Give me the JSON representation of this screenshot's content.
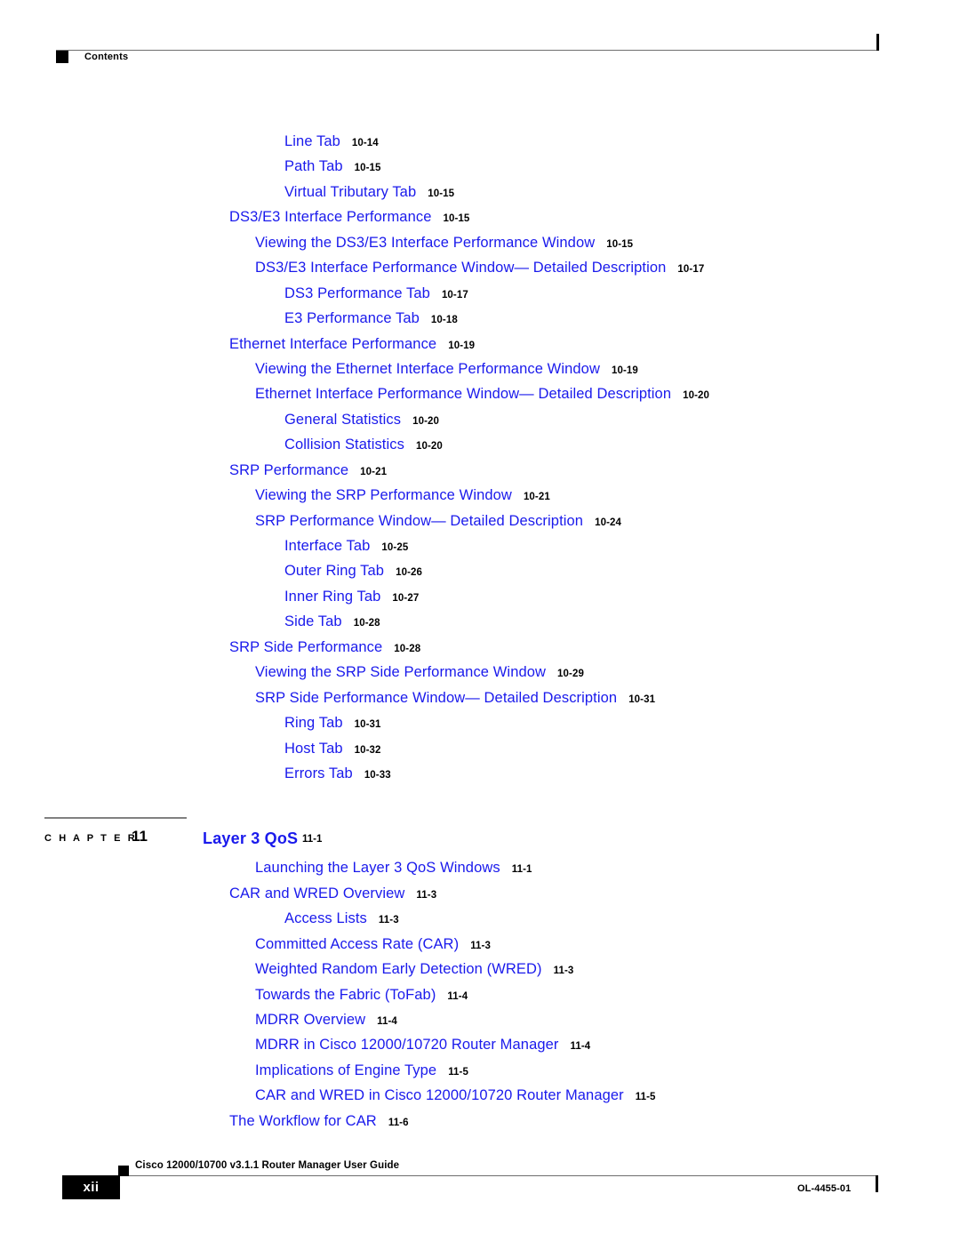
{
  "header": {
    "label": "Contents",
    "marker_icon": "black-square-icon"
  },
  "toc": {
    "entries": [
      {
        "title": "Line Tab",
        "page": "10-14",
        "level": 3
      },
      {
        "title": "Path Tab",
        "page": "10-15",
        "level": 3
      },
      {
        "title": "Virtual Tributary Tab",
        "page": "10-15",
        "level": 3
      },
      {
        "title": "DS3/E3 Interface Performance",
        "page": "10-15",
        "level": 1
      },
      {
        "title": "Viewing the DS3/E3 Interface Performance Window",
        "page": "10-15",
        "level": 2
      },
      {
        "title": "DS3/E3 Interface Performance Window— Detailed Description",
        "page": "10-17",
        "level": 2
      },
      {
        "title": "DS3 Performance Tab",
        "page": "10-17",
        "level": 3
      },
      {
        "title": "E3 Performance Tab",
        "page": "10-18",
        "level": 3
      },
      {
        "title": "Ethernet Interface Performance",
        "page": "10-19",
        "level": 1
      },
      {
        "title": "Viewing the Ethernet Interface Performance Window",
        "page": "10-19",
        "level": 2
      },
      {
        "title": "Ethernet Interface Performance Window— Detailed Description",
        "page": "10-20",
        "level": 2
      },
      {
        "title": "General Statistics",
        "page": "10-20",
        "level": 3
      },
      {
        "title": "Collision Statistics",
        "page": "10-20",
        "level": 3
      },
      {
        "title": "SRP Performance",
        "page": "10-21",
        "level": 1
      },
      {
        "title": "Viewing the SRP Performance Window",
        "page": "10-21",
        "level": 2
      },
      {
        "title": "SRP Performance Window— Detailed Description",
        "page": "10-24",
        "level": 2
      },
      {
        "title": "Interface Tab",
        "page": "10-25",
        "level": 3
      },
      {
        "title": "Outer Ring Tab",
        "page": "10-26",
        "level": 3
      },
      {
        "title": "Inner Ring Tab",
        "page": "10-27",
        "level": 3
      },
      {
        "title": "Side Tab",
        "page": "10-28",
        "level": 3
      },
      {
        "title": "SRP Side Performance",
        "page": "10-28",
        "level": 1
      },
      {
        "title": "Viewing the SRP Side Performance Window",
        "page": "10-29",
        "level": 2
      },
      {
        "title": "SRP Side Performance Window— Detailed Description",
        "page": "10-31",
        "level": 2
      },
      {
        "title": "Ring Tab",
        "page": "10-31",
        "level": 3
      },
      {
        "title": "Host Tab",
        "page": "10-32",
        "level": 3
      },
      {
        "title": "Errors Tab",
        "page": "10-33",
        "level": 3
      }
    ]
  },
  "chapter": {
    "word": "C H A P T E R",
    "number": "11",
    "title": "Layer 3 QoS",
    "page": "11-1"
  },
  "toc2": {
    "entries": [
      {
        "title": "Launching the Layer 3 QoS Windows",
        "page": "11-1",
        "level": 2
      },
      {
        "title": "CAR and WRED Overview",
        "page": "11-3",
        "level": 1
      },
      {
        "title": "Access Lists",
        "page": "11-3",
        "level": 3
      },
      {
        "title": "Committed Access Rate (CAR)",
        "page": "11-3",
        "level": 2
      },
      {
        "title": "Weighted Random Early Detection (WRED)",
        "page": "11-3",
        "level": 2
      },
      {
        "title": "Towards the Fabric (ToFab)",
        "page": "11-4",
        "level": 2
      },
      {
        "title": "MDRR Overview",
        "page": "11-4",
        "level": 2
      },
      {
        "title": "MDRR in Cisco 12000/10720 Router Manager",
        "page": "11-4",
        "level": 2
      },
      {
        "title": "Implications of Engine Type",
        "page": "11-5",
        "level": 2
      },
      {
        "title": "CAR and WRED in Cisco 12000/10720 Router Manager",
        "page": "11-5",
        "level": 2
      },
      {
        "title": "The Workflow for CAR",
        "page": "11-6",
        "level": 1
      }
    ]
  },
  "footer": {
    "page_number": "xii",
    "guide_title": "Cisco 12000/10700 v3.1.1 Router Manager User Guide",
    "doc_id": "OL-4455-01",
    "marker_icon": "black-square-icon"
  },
  "colors": {
    "link_blue": "#1a1aec",
    "rule_gray": "#6e6e6e",
    "marker_black": "#000000"
  }
}
